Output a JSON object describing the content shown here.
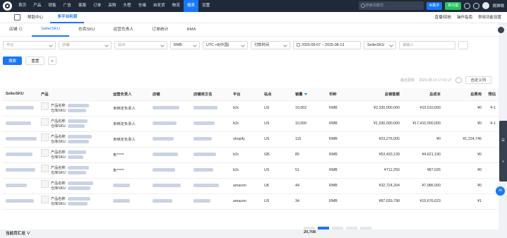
{
  "topbar": {
    "nav": [
      "首页",
      "产品",
      "销售",
      "广告",
      "客服",
      "订单",
      "采购",
      "头程",
      "仓储",
      "自发货",
      "物流",
      "报表",
      "设置"
    ],
    "active_nav": "报表",
    "search_placeholder": "搜索关键词",
    "ai_label": "AI助手",
    "new_label": "新功能",
    "user": "姚雅微"
  },
  "tabbar": {
    "tabs": [
      "帮助中心",
      "多平台利润"
    ],
    "active_tab": "多平台利润",
    "links": [
      "直播/回放",
      "操作指南",
      "常用功能设置"
    ]
  },
  "subtabs": [
    "店铺 ⊙",
    "SellerSKU",
    "仓库SKU",
    "运营负责人",
    "订单统计",
    "RMA"
  ],
  "active_subtab": "SellerSKU",
  "filters": {
    "platform": "平台",
    "site": "店铺",
    "warehouse": "站点",
    "currency": "RMB",
    "timezone": "UTC +8(中国)",
    "time_type": "付款时间",
    "date_start": "2025-08-07",
    "date_sep": "~",
    "date_end": "2025-08-13",
    "sku_type": "SellerSKU",
    "keyword_placeholder": "请输入"
  },
  "actions": {
    "search": "搜索",
    "reset": "重置",
    "plus": "+"
  },
  "meta": {
    "updated_label": "最后更新:",
    "updated_time": "2025-08-14 17:01:27",
    "custom_cols": "自定义列"
  },
  "columns": [
    "SellerSKU",
    "产品",
    "运营负责人",
    "店铺",
    "店铺英文名",
    "平台",
    "站点",
    "销量",
    "币种",
    "总销售额",
    "总成本",
    "总费用",
    "预估"
  ],
  "rows": [
    {
      "owner": "未绑定负责人",
      "platform": "b2c",
      "site": "US",
      "qty": "10,002",
      "cur": "RMB",
      "sales": "¥2,330,000,000",
      "cost": "¥10,010,000",
      "fee": "¥0",
      "est": "¥-1"
    },
    {
      "owner": "未绑定负责人",
      "platform": "b2c",
      "site": "US",
      "qty": "10,000",
      "cur": "RMB",
      "sales": "¥1,330,000,000",
      "cost": "¥17,410,000,000",
      "fee": "¥0",
      "est": "¥-1"
    },
    {
      "owner": "未绑定负责人",
      "platform": "shopify",
      "site": "US",
      "qty": "115",
      "cur": "RMB",
      "sales": "¥23,276,005",
      "cost": "¥0",
      "fee": "¥1,224,745",
      "est": ""
    },
    {
      "owner": "朱*****",
      "platform": "b2c",
      "site": "GB",
      "qty": "85",
      "cur": "RMB",
      "sales": "¥53,433,139",
      "cost": "¥4,621,190",
      "fee": "¥0",
      "est": ""
    },
    {
      "owner": "朱*****",
      "platform": "b2c",
      "site": "US",
      "qty": "51",
      "cur": "RMB",
      "sales": "¥712,250",
      "cost": "¥87,026",
      "fee": "¥0",
      "est": ""
    },
    {
      "owner": "",
      "platform": "amazon",
      "site": "UK",
      "qty": "44",
      "cur": "RMB",
      "sales": "¥32,724,204",
      "cost": "¥7,986,000",
      "fee": "¥0",
      "est": ""
    },
    {
      "owner": "",
      "platform": "amazon",
      "site": "US",
      "qty": "34",
      "cur": "RMB",
      "sales": "¥87,039,798",
      "cost": "¥15,676,623",
      "fee": "¥1",
      "est": ""
    }
  ],
  "product_labels": {
    "name": "产品名称:",
    "sku": "仓库SKU:"
  },
  "footer": {
    "label": "当前页汇总 ∨",
    "total_qty": "20,708"
  },
  "rail": {
    "label": "AI"
  },
  "colors": {
    "primary": "#1677ff",
    "topbar": "#1f2937",
    "green": "#22c55e"
  }
}
